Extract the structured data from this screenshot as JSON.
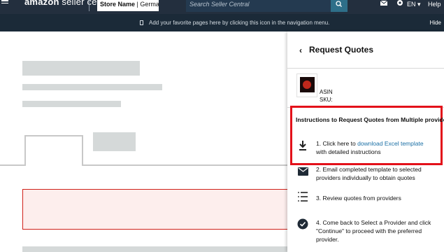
{
  "topbar": {
    "logo_brand": "amazon",
    "logo_suffix": " seller central",
    "store_label": "Store Name",
    "store_sep": " | ",
    "store_value": "Germany",
    "search_placeholder": "Search Seller Central",
    "language": "EN ▾",
    "help": "Help"
  },
  "subbar": {
    "message": "Add your favorite pages here by clicking this icon in the navigation menu.",
    "hide": "Hide"
  },
  "panel": {
    "back_chevron": "‹",
    "title": "Request Quotes",
    "asin_label": "ASIN",
    "sku_label": "SKU:",
    "instructions_title": "Instructions to Request Quotes from Multiple providers",
    "step1_prefix": "1. Click here to ",
    "step1_link": "download Excel template",
    "step1_suffix": "with detailed instructions",
    "step2": "2. Email completed template to selected providers individually to obtain quotes",
    "step3": "3. Review quotes from providers",
    "step4": "4. Come back to Select a Provider and click \"Continue\" to proceed with the preferred provider."
  },
  "colors": {
    "topbar_bg": "#232f3e",
    "subbar_bg": "#1b2a38",
    "highlight_red": "#e3111a",
    "link_blue": "#1a6fa5"
  }
}
